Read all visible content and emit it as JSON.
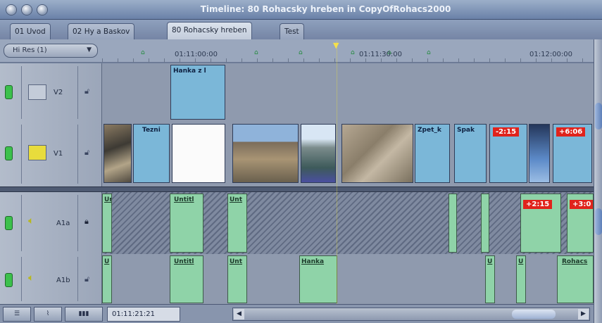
{
  "window": {
    "title": "Timeline: 80 Rohacsky hreben in CopyOfRohacs2000"
  },
  "tabs": [
    {
      "label": "01 Uvod"
    },
    {
      "label": "02 Hy a Baskov"
    },
    {
      "label": "80 Rohacsky hreben",
      "active": true
    },
    {
      "label": "Test"
    }
  ],
  "ruler": {
    "resolution_selector": "Hi Res (1)",
    "timecodes": [
      "01:11:00:00",
      "01:11:30:00",
      "01:12:00:00"
    ]
  },
  "tracks": {
    "v2": {
      "name": "V2",
      "clips": [
        "Hanka z l"
      ]
    },
    "v1": {
      "name": "V1",
      "clips": [
        "Tezni",
        "Zpet_k",
        "Spak"
      ],
      "speed_badges": [
        "-2:15",
        "+6:06"
      ]
    },
    "a1a": {
      "name": "A1a",
      "clips": [
        "Ur",
        "Untitl",
        "Unt"
      ],
      "speed_badges": [
        "+2:15",
        "+3:0"
      ]
    },
    "a1b": {
      "name": "A1b",
      "clips": [
        "U",
        "Untitl",
        "Unt",
        "Hanka",
        "U",
        "U",
        "Rohacs"
      ]
    }
  },
  "bottom": {
    "timecode": "01:11:21:21"
  },
  "colors": {
    "video_clip": "#7bb7d8",
    "audio_clip": "#8fd3a8",
    "speed_badge": "#e0231c",
    "enable_indicator": "#3cc04c",
    "playhead": "#f2e23a"
  }
}
